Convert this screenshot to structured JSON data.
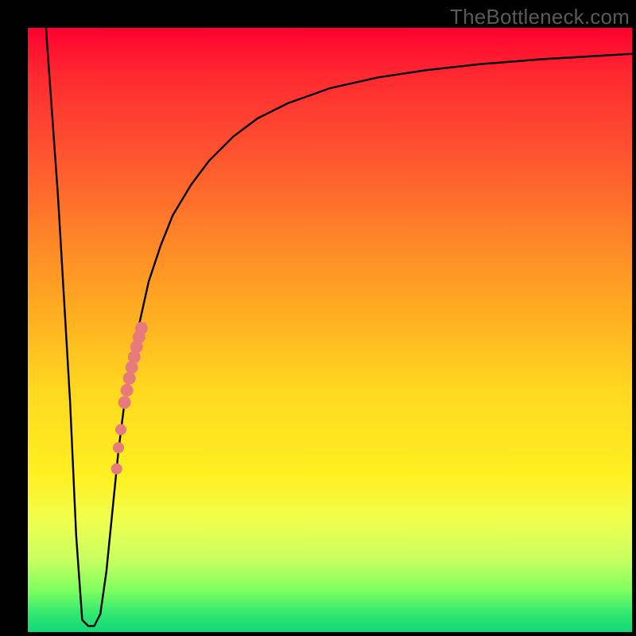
{
  "watermark": "TheBottleneck.com",
  "chart_data": {
    "type": "line",
    "title": "",
    "xlabel": "",
    "ylabel": "",
    "xlim": [
      0,
      100
    ],
    "ylim": [
      0,
      100
    ],
    "grid": false,
    "legend": false,
    "series": [
      {
        "name": "bottleneck-curve",
        "color": "#000000",
        "x": [
          3,
          5,
          7,
          8,
          9,
          10,
          11,
          12,
          13,
          14,
          15,
          16,
          18,
          20,
          22,
          24,
          27,
          30,
          34,
          38,
          43,
          50,
          58,
          66,
          75,
          85,
          95,
          100
        ],
        "y": [
          100,
          72,
          38,
          16,
          2,
          1,
          1,
          3,
          10,
          20,
          30,
          38,
          49,
          58,
          64,
          69,
          74,
          78,
          82,
          85,
          87.5,
          90,
          91.8,
          93,
          94,
          94.8,
          95.4,
          95.7
        ]
      }
    ],
    "markers": {
      "name": "highlighted-points",
      "color": "#e77a7a",
      "radius_large": 8,
      "radius_small": 7,
      "points": [
        {
          "x": 16.0,
          "y": 38.0
        },
        {
          "x": 16.4,
          "y": 40.0
        },
        {
          "x": 16.8,
          "y": 42.0
        },
        {
          "x": 17.2,
          "y": 43.8
        },
        {
          "x": 17.6,
          "y": 45.5
        },
        {
          "x": 18.0,
          "y": 47.2
        },
        {
          "x": 18.4,
          "y": 48.8
        },
        {
          "x": 18.8,
          "y": 50.3
        },
        {
          "x": 15.4,
          "y": 33.5
        },
        {
          "x": 15.0,
          "y": 30.5
        },
        {
          "x": 14.7,
          "y": 27.0
        }
      ]
    },
    "annotations": []
  }
}
